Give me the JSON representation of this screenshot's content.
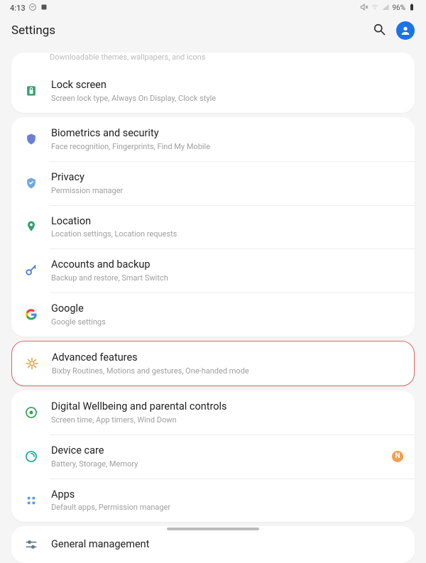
{
  "statusBar": {
    "time": "4:13",
    "batteryPct": "96%"
  },
  "header": {
    "title": "Settings"
  },
  "topPartial": {
    "subtitle": "Downloadable themes, wallpapers, and icons"
  },
  "groups": [
    {
      "items": [
        {
          "id": "lock-screen",
          "icon": "lock",
          "iconColor": "#2fa36d",
          "title": "Lock screen",
          "subtitle": "Screen lock type, Always On Display, Clock style"
        }
      ]
    },
    {
      "items": [
        {
          "id": "biometrics",
          "icon": "shield",
          "iconColor": "#6a7fd8",
          "title": "Biometrics and security",
          "subtitle": "Face recognition, Fingerprints, Find My Mobile"
        },
        {
          "id": "privacy",
          "icon": "shield-check",
          "iconColor": "#6fa9e0",
          "title": "Privacy",
          "subtitle": "Permission manager"
        },
        {
          "id": "location",
          "icon": "pin",
          "iconColor": "#2fa36d",
          "title": "Location",
          "subtitle": "Location settings, Location requests"
        },
        {
          "id": "accounts",
          "icon": "key",
          "iconColor": "#4a7ed6",
          "title": "Accounts and backup",
          "subtitle": "Backup and restore, Smart Switch"
        },
        {
          "id": "google",
          "icon": "google",
          "iconColor": "#4285f4",
          "title": "Google",
          "subtitle": "Google settings"
        }
      ]
    },
    {
      "highlight": true,
      "items": [
        {
          "id": "advanced",
          "icon": "gear-star",
          "iconColor": "#e6a33c",
          "title": "Advanced features",
          "subtitle": "Bixby Routines, Motions and gestures, One-handed mode"
        }
      ]
    },
    {
      "items": [
        {
          "id": "wellbeing",
          "icon": "wellbeing",
          "iconColor": "#3a9b5c",
          "title": "Digital Wellbeing and parental controls",
          "subtitle": "Screen time, App timers, Wind Down"
        },
        {
          "id": "device-care",
          "icon": "care",
          "iconColor": "#1aa59a",
          "title": "Device care",
          "subtitle": "Battery, Storage, Memory",
          "badge": "N"
        },
        {
          "id": "apps",
          "icon": "apps",
          "iconColor": "#5b9be0",
          "title": "Apps",
          "subtitle": "Default apps, Permission manager"
        }
      ]
    },
    {
      "items": [
        {
          "id": "general",
          "icon": "sliders",
          "iconColor": "#607d8b",
          "title": "General management",
          "subtitle": ""
        }
      ]
    }
  ]
}
